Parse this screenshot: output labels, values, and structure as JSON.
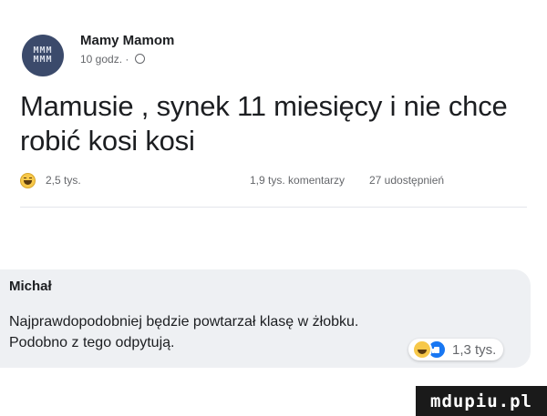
{
  "post": {
    "author": "Mamy Mamom",
    "time": "10 godz. ·",
    "text": "Mamusie , synek 11 miesięcy i nie chce robić kosi kosi",
    "likes": "2,5 tys.",
    "comments": "1,9 tys. komentarzy",
    "shares": "27 udostępnień"
  },
  "comment": {
    "author": "Michał",
    "text_line1": "Najprawdopodobniej będzie powtarzał klasę w żłobku.",
    "text_line2": "Podobno z tego odpytują.",
    "reaction_count": "1,3 tys."
  },
  "watermark": "mdupiu.pl",
  "colors": {
    "text": "#1c1e21",
    "secondary": "#65676b",
    "comment_bg": "#eef0f3",
    "like_blue": "#1877f2",
    "laugh_yellow": "#f7c84a"
  },
  "icons": {
    "avatar": "page-avatar",
    "laugh": "laugh-reaction-icon",
    "like": "like-reaction-icon",
    "privacy": "globe-icon"
  }
}
